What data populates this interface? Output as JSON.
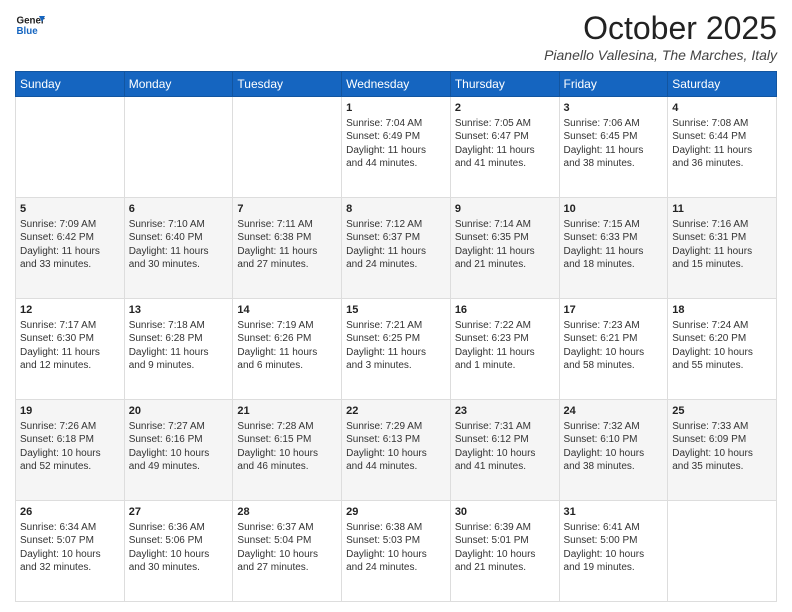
{
  "header": {
    "logo_line1": "General",
    "logo_line2": "Blue",
    "month_title": "October 2025",
    "location": "Pianello Vallesina, The Marches, Italy"
  },
  "days_of_week": [
    "Sunday",
    "Monday",
    "Tuesday",
    "Wednesday",
    "Thursday",
    "Friday",
    "Saturday"
  ],
  "weeks": [
    [
      {
        "day": "",
        "info": ""
      },
      {
        "day": "",
        "info": ""
      },
      {
        "day": "",
        "info": ""
      },
      {
        "day": "1",
        "info": "Sunrise: 7:04 AM\nSunset: 6:49 PM\nDaylight: 11 hours\nand 44 minutes."
      },
      {
        "day": "2",
        "info": "Sunrise: 7:05 AM\nSunset: 6:47 PM\nDaylight: 11 hours\nand 41 minutes."
      },
      {
        "day": "3",
        "info": "Sunrise: 7:06 AM\nSunset: 6:45 PM\nDaylight: 11 hours\nand 38 minutes."
      },
      {
        "day": "4",
        "info": "Sunrise: 7:08 AM\nSunset: 6:44 PM\nDaylight: 11 hours\nand 36 minutes."
      }
    ],
    [
      {
        "day": "5",
        "info": "Sunrise: 7:09 AM\nSunset: 6:42 PM\nDaylight: 11 hours\nand 33 minutes."
      },
      {
        "day": "6",
        "info": "Sunrise: 7:10 AM\nSunset: 6:40 PM\nDaylight: 11 hours\nand 30 minutes."
      },
      {
        "day": "7",
        "info": "Sunrise: 7:11 AM\nSunset: 6:38 PM\nDaylight: 11 hours\nand 27 minutes."
      },
      {
        "day": "8",
        "info": "Sunrise: 7:12 AM\nSunset: 6:37 PM\nDaylight: 11 hours\nand 24 minutes."
      },
      {
        "day": "9",
        "info": "Sunrise: 7:14 AM\nSunset: 6:35 PM\nDaylight: 11 hours\nand 21 minutes."
      },
      {
        "day": "10",
        "info": "Sunrise: 7:15 AM\nSunset: 6:33 PM\nDaylight: 11 hours\nand 18 minutes."
      },
      {
        "day": "11",
        "info": "Sunrise: 7:16 AM\nSunset: 6:31 PM\nDaylight: 11 hours\nand 15 minutes."
      }
    ],
    [
      {
        "day": "12",
        "info": "Sunrise: 7:17 AM\nSunset: 6:30 PM\nDaylight: 11 hours\nand 12 minutes."
      },
      {
        "day": "13",
        "info": "Sunrise: 7:18 AM\nSunset: 6:28 PM\nDaylight: 11 hours\nand 9 minutes."
      },
      {
        "day": "14",
        "info": "Sunrise: 7:19 AM\nSunset: 6:26 PM\nDaylight: 11 hours\nand 6 minutes."
      },
      {
        "day": "15",
        "info": "Sunrise: 7:21 AM\nSunset: 6:25 PM\nDaylight: 11 hours\nand 3 minutes."
      },
      {
        "day": "16",
        "info": "Sunrise: 7:22 AM\nSunset: 6:23 PM\nDaylight: 11 hours\nand 1 minute."
      },
      {
        "day": "17",
        "info": "Sunrise: 7:23 AM\nSunset: 6:21 PM\nDaylight: 10 hours\nand 58 minutes."
      },
      {
        "day": "18",
        "info": "Sunrise: 7:24 AM\nSunset: 6:20 PM\nDaylight: 10 hours\nand 55 minutes."
      }
    ],
    [
      {
        "day": "19",
        "info": "Sunrise: 7:26 AM\nSunset: 6:18 PM\nDaylight: 10 hours\nand 52 minutes."
      },
      {
        "day": "20",
        "info": "Sunrise: 7:27 AM\nSunset: 6:16 PM\nDaylight: 10 hours\nand 49 minutes."
      },
      {
        "day": "21",
        "info": "Sunrise: 7:28 AM\nSunset: 6:15 PM\nDaylight: 10 hours\nand 46 minutes."
      },
      {
        "day": "22",
        "info": "Sunrise: 7:29 AM\nSunset: 6:13 PM\nDaylight: 10 hours\nand 44 minutes."
      },
      {
        "day": "23",
        "info": "Sunrise: 7:31 AM\nSunset: 6:12 PM\nDaylight: 10 hours\nand 41 minutes."
      },
      {
        "day": "24",
        "info": "Sunrise: 7:32 AM\nSunset: 6:10 PM\nDaylight: 10 hours\nand 38 minutes."
      },
      {
        "day": "25",
        "info": "Sunrise: 7:33 AM\nSunset: 6:09 PM\nDaylight: 10 hours\nand 35 minutes."
      }
    ],
    [
      {
        "day": "26",
        "info": "Sunrise: 6:34 AM\nSunset: 5:07 PM\nDaylight: 10 hours\nand 32 minutes."
      },
      {
        "day": "27",
        "info": "Sunrise: 6:36 AM\nSunset: 5:06 PM\nDaylight: 10 hours\nand 30 minutes."
      },
      {
        "day": "28",
        "info": "Sunrise: 6:37 AM\nSunset: 5:04 PM\nDaylight: 10 hours\nand 27 minutes."
      },
      {
        "day": "29",
        "info": "Sunrise: 6:38 AM\nSunset: 5:03 PM\nDaylight: 10 hours\nand 24 minutes."
      },
      {
        "day": "30",
        "info": "Sunrise: 6:39 AM\nSunset: 5:01 PM\nDaylight: 10 hours\nand 21 minutes."
      },
      {
        "day": "31",
        "info": "Sunrise: 6:41 AM\nSunset: 5:00 PM\nDaylight: 10 hours\nand 19 minutes."
      },
      {
        "day": "",
        "info": ""
      }
    ]
  ]
}
